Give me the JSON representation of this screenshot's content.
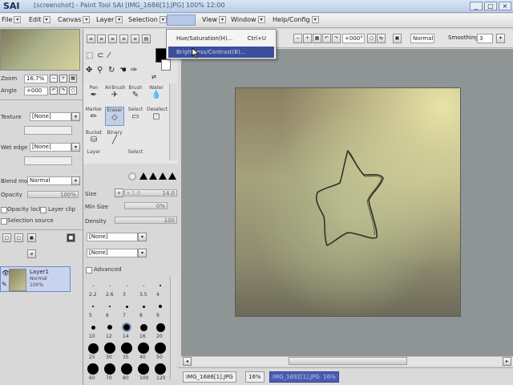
{
  "window": {
    "title": "[screenshot] - Paint Tool SAI  [IMG_1686[1].JPG]  100% 12:00",
    "logo": "SAI",
    "controls": [
      "_",
      "□",
      "×"
    ]
  },
  "menu": {
    "items": [
      {
        "label": "File"
      },
      {
        "label": "Edit"
      },
      {
        "label": "Canvas"
      },
      {
        "label": "Layer"
      },
      {
        "label": "Selection"
      },
      {
        "label": "Filter"
      },
      {
        "label": "View"
      },
      {
        "label": "Window"
      },
      {
        "label": "Help/Config"
      }
    ]
  },
  "dropdown": {
    "items": [
      {
        "label": "Hue/Saturation(H)...",
        "shortcut": "Ctrl+U"
      },
      {
        "label": "Brightness/Contrast(B)...",
        "shortcut": ""
      }
    ]
  },
  "toolbar": {
    "zoom": "16%",
    "angle": "+000°",
    "blend": "Normal",
    "smoothing_label": "Smoothing",
    "smoothing_value": "3"
  },
  "navigator": {
    "zoom_label": "Zoom",
    "zoom_value": "16.7%",
    "angle_label": "Angle",
    "angle_value": "+000"
  },
  "brush_settings": {
    "texture_label": "Texture",
    "texture_value": "[None]",
    "wetedge_label": "Wet edge",
    "wetedge_value": "[None]",
    "blend_label": "Blend mode",
    "blend_value": "Normal",
    "opacity_label": "Opacity",
    "opacity_value": "100%",
    "protect_label": "Opacity lock",
    "clip_label": "Layer clip",
    "source_label": "Selection source"
  },
  "tools": [
    {
      "label": "Pen",
      "icon": "✒"
    },
    {
      "label": "AirBrush",
      "icon": "✈"
    },
    {
      "label": "Brush",
      "icon": "✎"
    },
    {
      "label": "Water",
      "icon": "💧"
    },
    {
      "label": "Marker",
      "icon": "✏"
    },
    {
      "label": "Eraser",
      "icon": "◇"
    },
    {
      "label": "Select",
      "icon": "▭"
    },
    {
      "label": "Deselect",
      "icon": "▢"
    },
    {
      "label": "Bucket",
      "icon": "⛁"
    },
    {
      "label": "Binary",
      "icon": "╱"
    },
    {
      "label": "Layer",
      "icon": ""
    },
    {
      "label": "Select",
      "icon": ""
    }
  ],
  "tool_options": {
    "size_label": "Size",
    "size_mult": "x 1.0",
    "size_value": "14.0",
    "minsize_label": "Min Size",
    "minsize_value": "0%",
    "density_label": "Density",
    "density_value": "100",
    "texture_value": "[None]",
    "shape_value": "[None]",
    "advanced_label": "Advanced"
  },
  "brush_tips": [
    {
      "label": "2.2",
      "d": 1
    },
    {
      "label": "2.6",
      "d": 1
    },
    {
      "label": "3",
      "d": 1
    },
    {
      "label": "3.5",
      "d": 1
    },
    {
      "label": "4",
      "d": 2
    },
    {
      "label": "5",
      "d": 2
    },
    {
      "label": "6",
      "d": 2
    },
    {
      "label": "7",
      "d": 3
    },
    {
      "label": "8",
      "d": 3
    },
    {
      "label": "9",
      "d": 4
    },
    {
      "label": "10",
      "d": 5
    },
    {
      "label": "12",
      "d": 6
    },
    {
      "label": "14",
      "d": 8
    },
    {
      "label": "16",
      "d": 9
    },
    {
      "label": "20",
      "d": 11
    },
    {
      "label": "25",
      "d": 13
    },
    {
      "label": "30",
      "d": 14
    },
    {
      "label": "35",
      "d": 14
    },
    {
      "label": "40",
      "d": 14
    },
    {
      "label": "50",
      "d": 14
    },
    {
      "label": "60",
      "d": 14
    },
    {
      "label": "70",
      "d": 14
    },
    {
      "label": "80",
      "d": 14
    },
    {
      "label": "100",
      "d": 14
    },
    {
      "label": "120",
      "d": 14
    }
  ],
  "layer": {
    "name": "Layer1",
    "mode": "Normal",
    "opacity": "100%"
  },
  "status": {
    "tab1": "IMG_1686[1].JPG",
    "tab1_zoom": "16%",
    "tab2": "IMG_1692[1].JPG",
    "tab2_zoom": "16%"
  }
}
